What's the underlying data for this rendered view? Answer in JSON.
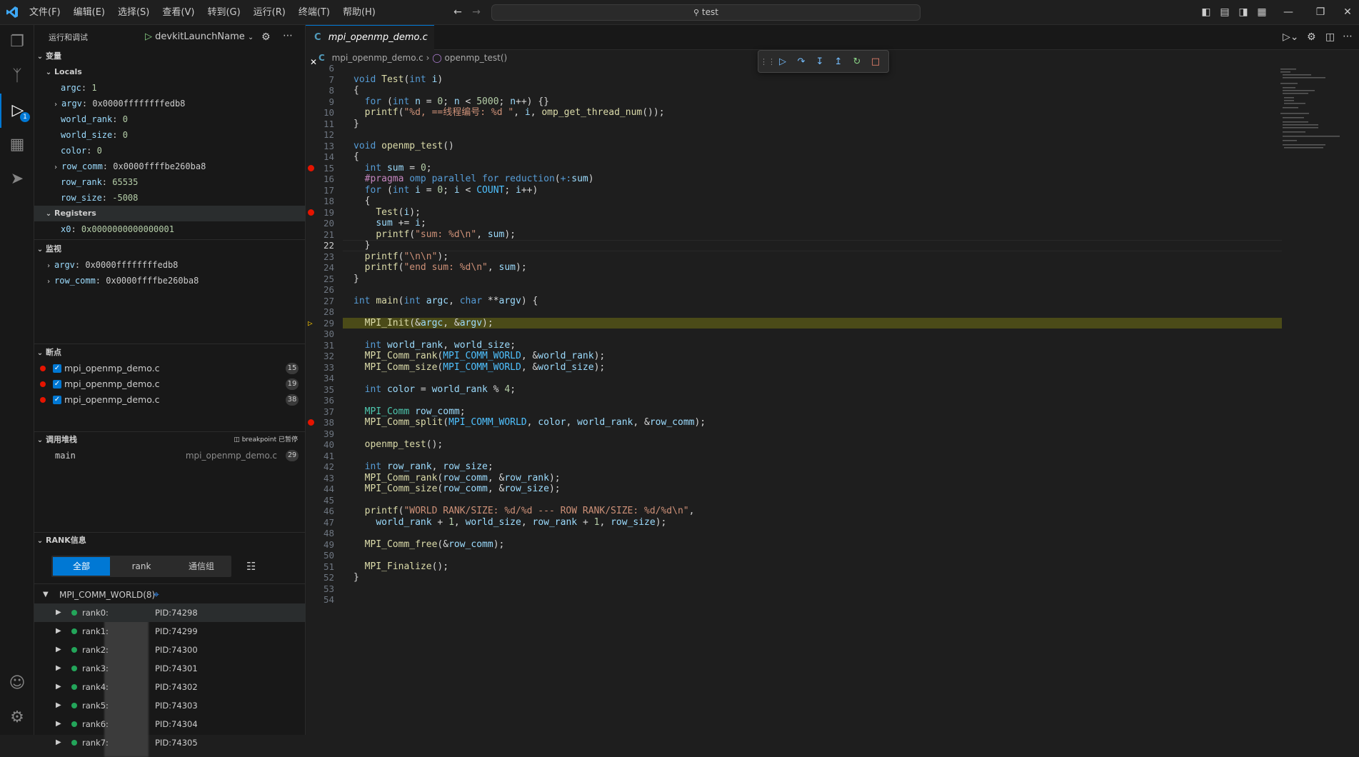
{
  "menubar": {
    "items": [
      "文件(F)",
      "编辑(E)",
      "选择(S)",
      "查看(V)",
      "转到(G)",
      "运行(R)",
      "终端(T)",
      "帮助(H)"
    ],
    "search": "test"
  },
  "sidebar": {
    "title": "运行和调试",
    "launch_config": "devkitLaunchName",
    "variables": {
      "header": "变量",
      "locals_header": "Locals",
      "locals": [
        {
          "name": "argc",
          "value": "1",
          "expandable": false
        },
        {
          "name": "argv",
          "value": "0x0000ffffffffedb8",
          "expandable": true
        },
        {
          "name": "world_rank",
          "value": "0",
          "expandable": false
        },
        {
          "name": "world_size",
          "value": "0",
          "expandable": false
        },
        {
          "name": "color",
          "value": "0",
          "expandable": false
        },
        {
          "name": "row_comm",
          "value": "0x0000ffffbe260ba8",
          "expandable": true
        },
        {
          "name": "row_rank",
          "value": "65535",
          "expandable": false
        },
        {
          "name": "row_size",
          "value": "-5008",
          "expandable": false
        }
      ],
      "registers_header": "Registers",
      "registers": [
        {
          "name": "x0",
          "value": "0x0000000000000001"
        }
      ]
    },
    "watch": {
      "header": "监视",
      "items": [
        {
          "name": "argv",
          "value": "0x0000ffffffffedb8"
        },
        {
          "name": "row_comm",
          "value": "0x0000ffffbe260ba8"
        }
      ]
    },
    "breakpoints": {
      "header": "断点",
      "items": [
        {
          "file": "mpi_openmp_demo.c",
          "line": "15"
        },
        {
          "file": "mpi_openmp_demo.c",
          "line": "19"
        },
        {
          "file": "mpi_openmp_demo.c",
          "line": "38"
        }
      ]
    },
    "callstack": {
      "header": "调用堆栈",
      "status": "breakpoint 已暂停",
      "frames": [
        {
          "name": "main",
          "file": "mpi_openmp_demo.c",
          "line": "29"
        }
      ]
    },
    "rank": {
      "header": "RANK信息",
      "tabs": [
        "全部",
        "rank",
        "通信组"
      ],
      "group": "MPI_COMM_WORLD(8)",
      "ranks": [
        {
          "name": "rank0:",
          "pid": "PID:74298"
        },
        {
          "name": "rank1:",
          "pid": "PID:74299"
        },
        {
          "name": "rank2:",
          "pid": "PID:74300"
        },
        {
          "name": "rank3:",
          "pid": "PID:74301"
        },
        {
          "name": "rank4:",
          "pid": "PID:74302"
        },
        {
          "name": "rank5:",
          "pid": "PID:74303"
        },
        {
          "name": "rank6:",
          "pid": "PID:74304"
        },
        {
          "name": "rank7:",
          "pid": "PID:74305"
        }
      ]
    }
  },
  "editor": {
    "tab_label": "mpi_openmp_demo.c",
    "breadcrumb": {
      "file": "mpi_openmp_demo.c",
      "symbol": "openmp_test()"
    },
    "current_line": "29",
    "lines": [
      {
        "n": "6",
        "t": ""
      },
      {
        "n": "7",
        "t": "void Test(int i)"
      },
      {
        "n": "8",
        "t": "{"
      },
      {
        "n": "9",
        "t": "  for (int n = 0; n < 5000; n++) {}"
      },
      {
        "n": "10",
        "t": "  printf(\"%d, ==线程编号: %d \", i, omp_get_thread_num());"
      },
      {
        "n": "11",
        "t": "}"
      },
      {
        "n": "12",
        "t": ""
      },
      {
        "n": "13",
        "t": "void openmp_test()"
      },
      {
        "n": "14",
        "t": "{"
      },
      {
        "n": "15",
        "t": "  int sum = 0;"
      },
      {
        "n": "16",
        "t": "  #pragma omp parallel for reduction(+:sum)"
      },
      {
        "n": "17",
        "t": "  for (int i = 0; i < COUNT; i++)"
      },
      {
        "n": "18",
        "t": "  {"
      },
      {
        "n": "19",
        "t": "    Test(i);"
      },
      {
        "n": "20",
        "t": "    sum += i;"
      },
      {
        "n": "21",
        "t": "    printf(\"sum: %d\\n\", sum);"
      },
      {
        "n": "22",
        "t": "  }"
      },
      {
        "n": "23",
        "t": "  printf(\"\\n\\n\");"
      },
      {
        "n": "24",
        "t": "  printf(\"end sum: %d\\n\", sum);"
      },
      {
        "n": "25",
        "t": "}"
      },
      {
        "n": "26",
        "t": ""
      },
      {
        "n": "27",
        "t": "int main(int argc, char **argv) {"
      },
      {
        "n": "28",
        "t": ""
      },
      {
        "n": "29",
        "t": "  MPI_Init(&argc, &argv);"
      },
      {
        "n": "30",
        "t": ""
      },
      {
        "n": "31",
        "t": "  int world_rank, world_size;"
      },
      {
        "n": "32",
        "t": "  MPI_Comm_rank(MPI_COMM_WORLD, &world_rank);"
      },
      {
        "n": "33",
        "t": "  MPI_Comm_size(MPI_COMM_WORLD, &world_size);"
      },
      {
        "n": "34",
        "t": ""
      },
      {
        "n": "35",
        "t": "  int color = world_rank % 4;"
      },
      {
        "n": "36",
        "t": ""
      },
      {
        "n": "37",
        "t": "  MPI_Comm row_comm;"
      },
      {
        "n": "38",
        "t": "  MPI_Comm_split(MPI_COMM_WORLD, color, world_rank, &row_comm);"
      },
      {
        "n": "39",
        "t": ""
      },
      {
        "n": "40",
        "t": "  openmp_test();"
      },
      {
        "n": "41",
        "t": ""
      },
      {
        "n": "42",
        "t": "  int row_rank, row_size;"
      },
      {
        "n": "43",
        "t": "  MPI_Comm_rank(row_comm, &row_rank);"
      },
      {
        "n": "44",
        "t": "  MPI_Comm_size(row_comm, &row_size);"
      },
      {
        "n": "45",
        "t": ""
      },
      {
        "n": "46",
        "t": "  printf(\"WORLD RANK/SIZE: %d/%d --- ROW RANK/SIZE: %d/%d\\n\","
      },
      {
        "n": "47",
        "t": "    world_rank + 1, world_size, row_rank + 1, row_size);"
      },
      {
        "n": "48",
        "t": ""
      },
      {
        "n": "49",
        "t": "  MPI_Comm_free(&row_comm);"
      },
      {
        "n": "50",
        "t": ""
      },
      {
        "n": "51",
        "t": "  MPI_Finalize();"
      },
      {
        "n": "52",
        "t": "}"
      },
      {
        "n": "53",
        "t": ""
      },
      {
        "n": "54",
        "t": ""
      }
    ],
    "breakpoint_lines": [
      "15",
      "19",
      "38"
    ]
  },
  "colors": {
    "accent": "#0078d4",
    "breakpoint": "#e51400",
    "current_line_bg": "#4b4b18",
    "rank_active": "#23a55a"
  }
}
